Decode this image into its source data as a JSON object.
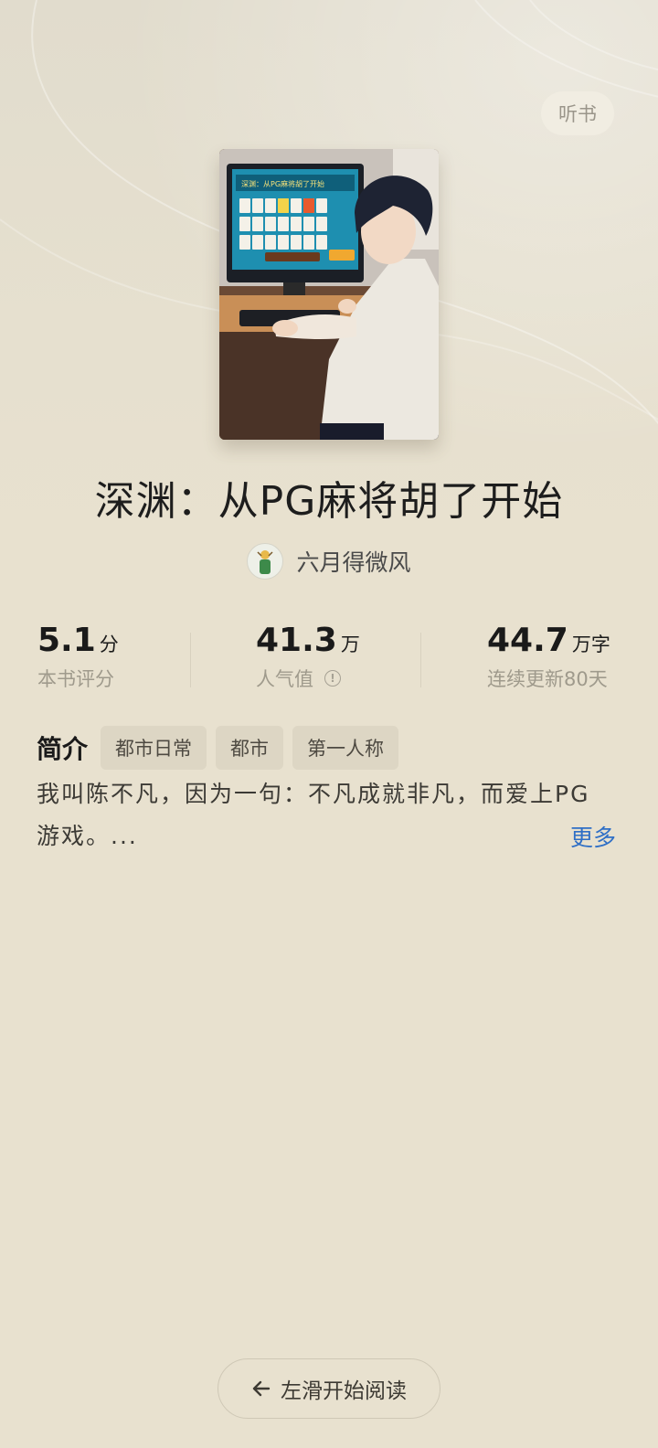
{
  "header": {
    "listen_label": "听书"
  },
  "book": {
    "title": "深渊：从PG麻将胡了开始",
    "author": "六月得微风",
    "cover_screen_title": "深渊：从PG麻将胡了开始"
  },
  "stats": {
    "rating": {
      "value": "5.1",
      "unit": "分",
      "label": "本书评分"
    },
    "popularity": {
      "value": "41.3",
      "unit": "万",
      "label": "人气值"
    },
    "words": {
      "value": "44.7",
      "unit": "万字",
      "label": "连续更新80天"
    }
  },
  "intro": {
    "heading": "简介",
    "tags": [
      "都市日常",
      "都市",
      "第一人称"
    ],
    "text_line1": "我叫陈不凡，因为一句：不凡成就非凡，而爱上PG",
    "text_line2": "游戏。...",
    "more_label": "更多"
  },
  "footer": {
    "read_label": "左滑开始阅读"
  },
  "colors": {
    "background": "#e8e1cf",
    "link": "#2f6fc6"
  }
}
